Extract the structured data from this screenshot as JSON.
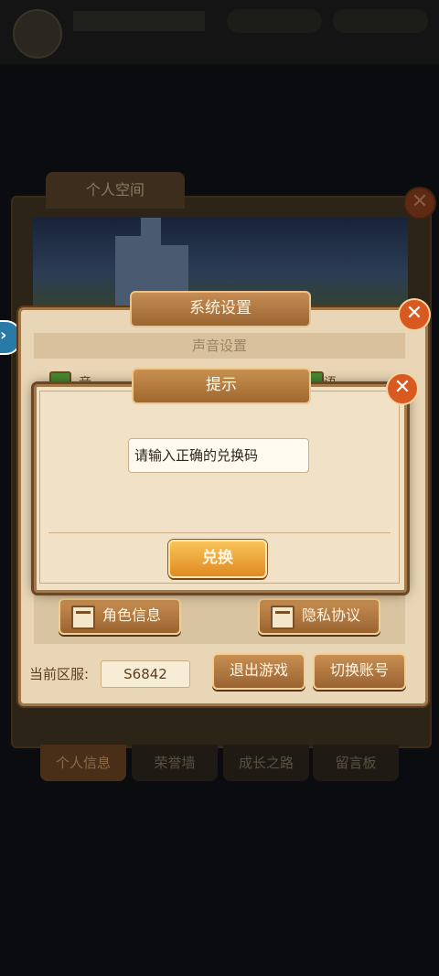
{
  "background": {
    "space_tab": "个人空间",
    "bottom_tabs": [
      "个人信息",
      "荣誉墙",
      "成长之路",
      "留言板"
    ],
    "close_symbol": "✕",
    "arrow_symbol": "›"
  },
  "settings": {
    "title": "系统设置",
    "close_symbol": "✕",
    "sound_section": "声音设置",
    "music_label": "音乐",
    "voice_label": "语音",
    "role_info_button": "角色信息",
    "privacy_button": "隐私协议",
    "zone_label": "当前区服:",
    "zone_value": "S6842",
    "exit_button": "退出游戏",
    "switch_account_button": "切换账号"
  },
  "prompt": {
    "title": "提示",
    "close_symbol": "✕",
    "input_value": "请输入正确的兑换码",
    "redeem_button": "兑换"
  }
}
